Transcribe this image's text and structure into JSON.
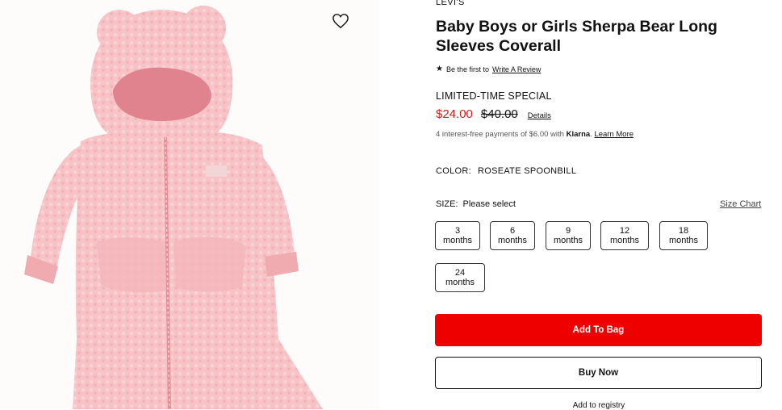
{
  "product": {
    "brand": "LEVI'S",
    "title": "Baby Boys or Girls Sherpa Bear Long Sleeves Coverall",
    "review_prefix": "Be the first to",
    "review_link": "Write A Review",
    "promo_label": "LIMITED-TIME SPECIAL",
    "price_sale": "$24.00",
    "price_original": "$40.00",
    "details_link": "Details",
    "klarna_text": "4 interest-free payments of $6.00 with",
    "klarna_brand": "Klarna",
    "klarna_learn": "Learn More",
    "color_label": "COLOR:",
    "color_value": "ROSEATE SPOONBILL",
    "size_label": "SIZE:",
    "size_value": "Please select",
    "size_chart": "Size Chart",
    "sizes": [
      "3 months",
      "6 months",
      "9 months",
      "12 months",
      "18 months",
      "24 months"
    ],
    "add_to_bag": "Add To Bag",
    "buy_now": "Buy Now",
    "registry": "Add to registry"
  },
  "icons": {
    "favorite": "heart-outline-icon",
    "review_star": "star-icon"
  },
  "colors": {
    "sale_price": "#d41c1c",
    "add_to_bag_bg": "#ee0000",
    "garment_pink": "#f6bfc3"
  }
}
